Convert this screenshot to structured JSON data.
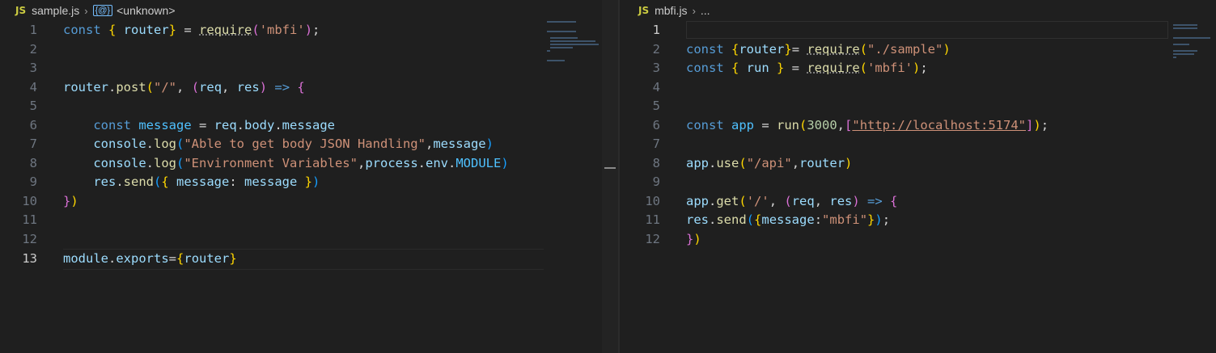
{
  "left": {
    "breadcrumb": {
      "lang": "JS",
      "file": "sample.js",
      "symbol": "<unknown>"
    },
    "lines": [
      {
        "n": "1",
        "tokens": [
          [
            "kw",
            "const "
          ],
          [
            "b1",
            "{ "
          ],
          [
            "vr",
            "router"
          ],
          [
            "b1",
            "}"
          ],
          [
            "pn",
            " = "
          ],
          [
            "fn",
            "require"
          ],
          [
            "b2",
            "("
          ],
          [
            "st",
            "'mbfi'"
          ],
          [
            "b2",
            ")"
          ],
          [
            "pn",
            ";"
          ]
        ]
      },
      {
        "n": "2",
        "tokens": []
      },
      {
        "n": "3",
        "tokens": []
      },
      {
        "n": "4",
        "tokens": [
          [
            "vr",
            "router"
          ],
          [
            "pn",
            "."
          ],
          [
            "fn",
            "post"
          ],
          [
            "b1",
            "("
          ],
          [
            "st",
            "\"/\""
          ],
          [
            "pn",
            ", "
          ],
          [
            "b2",
            "("
          ],
          [
            "vr",
            "req"
          ],
          [
            "pn",
            ", "
          ],
          [
            "vr",
            "res"
          ],
          [
            "b2",
            ")"
          ],
          [
            "kw",
            " => "
          ],
          [
            "b2",
            "{"
          ]
        ]
      },
      {
        "n": "5",
        "tokens": []
      },
      {
        "n": "6",
        "tokens": [
          [
            "pn",
            "    "
          ],
          [
            "kw",
            "const "
          ],
          [
            "cn",
            "message"
          ],
          [
            "pn",
            " = "
          ],
          [
            "vr",
            "req"
          ],
          [
            "pn",
            "."
          ],
          [
            "vr",
            "body"
          ],
          [
            "pn",
            "."
          ],
          [
            "vr",
            "message"
          ]
        ]
      },
      {
        "n": "7",
        "tokens": [
          [
            "pn",
            "    "
          ],
          [
            "vr",
            "console"
          ],
          [
            "pn",
            "."
          ],
          [
            "fn",
            "log"
          ],
          [
            "b3",
            "("
          ],
          [
            "st",
            "\"Able to get body JSON Handling\""
          ],
          [
            "pn",
            ","
          ],
          [
            "vr",
            "message"
          ],
          [
            "b3",
            ")"
          ]
        ]
      },
      {
        "n": "8",
        "tokens": [
          [
            "pn",
            "    "
          ],
          [
            "vr",
            "console"
          ],
          [
            "pn",
            "."
          ],
          [
            "fn",
            "log"
          ],
          [
            "b3",
            "("
          ],
          [
            "st",
            "\"Environment Variables\""
          ],
          [
            "pn",
            ","
          ],
          [
            "vr",
            "process"
          ],
          [
            "pn",
            "."
          ],
          [
            "vr",
            "env"
          ],
          [
            "pn",
            "."
          ],
          [
            "cn",
            "MODULE"
          ],
          [
            "b3",
            ")"
          ]
        ]
      },
      {
        "n": "9",
        "tokens": [
          [
            "pn",
            "    "
          ],
          [
            "vr",
            "res"
          ],
          [
            "pn",
            "."
          ],
          [
            "fn",
            "send"
          ],
          [
            "b3",
            "("
          ],
          [
            "b1",
            "{ "
          ],
          [
            "vr",
            "message"
          ],
          [
            "pn",
            ": "
          ],
          [
            "vr",
            "message"
          ],
          [
            "b1",
            " }"
          ],
          [
            "b3",
            ")"
          ]
        ]
      },
      {
        "n": "10",
        "tokens": [
          [
            "b2",
            "}"
          ],
          [
            "b1",
            ")"
          ]
        ]
      },
      {
        "n": "11",
        "tokens": []
      },
      {
        "n": "12",
        "tokens": []
      },
      {
        "n": "13",
        "tokens": [
          [
            "vr",
            "module"
          ],
          [
            "pn",
            "."
          ],
          [
            "vr",
            "exports"
          ],
          [
            "pn",
            "="
          ],
          [
            "b1",
            "{"
          ],
          [
            "vr",
            "router"
          ],
          [
            "b1",
            "}"
          ]
        ]
      }
    ]
  },
  "right": {
    "breadcrumb": {
      "lang": "JS",
      "file": "mbfi.js",
      "more": "..."
    },
    "lines": [
      {
        "n": "1",
        "tokens": []
      },
      {
        "n": "2",
        "tokens": [
          [
            "kw",
            "const "
          ],
          [
            "b1",
            "{"
          ],
          [
            "vr",
            "router"
          ],
          [
            "b1",
            "}"
          ],
          [
            "pn",
            "= "
          ],
          [
            "fn",
            "require"
          ],
          [
            "b1",
            "("
          ],
          [
            "st",
            "\"./sample\""
          ],
          [
            "b1",
            ")"
          ]
        ]
      },
      {
        "n": "3",
        "tokens": [
          [
            "kw",
            "const "
          ],
          [
            "b1",
            "{ "
          ],
          [
            "vr",
            "run"
          ],
          [
            "b1",
            " }"
          ],
          [
            "pn",
            " = "
          ],
          [
            "fn",
            "require"
          ],
          [
            "b1",
            "("
          ],
          [
            "st",
            "'mbfi'"
          ],
          [
            "b1",
            ")"
          ],
          [
            "pn",
            ";"
          ]
        ]
      },
      {
        "n": "4",
        "tokens": []
      },
      {
        "n": "5",
        "tokens": []
      },
      {
        "n": "6",
        "tokens": [
          [
            "kw",
            "const "
          ],
          [
            "cn",
            "app"
          ],
          [
            "pn",
            " = "
          ],
          [
            "fn",
            "run"
          ],
          [
            "b1",
            "("
          ],
          [
            "nm",
            "3000"
          ],
          [
            "pn",
            ","
          ],
          [
            "b2",
            "["
          ],
          [
            "st",
            "\"http://localhost:5174\""
          ],
          [
            "b2",
            "]"
          ],
          [
            "b1",
            ")"
          ],
          [
            "pn",
            ";"
          ]
        ]
      },
      {
        "n": "7",
        "tokens": []
      },
      {
        "n": "8",
        "tokens": [
          [
            "vr",
            "app"
          ],
          [
            "pn",
            "."
          ],
          [
            "fn",
            "use"
          ],
          [
            "b1",
            "("
          ],
          [
            "st",
            "\"/api\""
          ],
          [
            "pn",
            ","
          ],
          [
            "vr",
            "router"
          ],
          [
            "b1",
            ")"
          ]
        ]
      },
      {
        "n": "9",
        "tokens": []
      },
      {
        "n": "10",
        "tokens": [
          [
            "vr",
            "app"
          ],
          [
            "pn",
            "."
          ],
          [
            "fn",
            "get"
          ],
          [
            "b1",
            "("
          ],
          [
            "st",
            "'/'"
          ],
          [
            "pn",
            ", "
          ],
          [
            "b2",
            "("
          ],
          [
            "vr",
            "req"
          ],
          [
            "pn",
            ", "
          ],
          [
            "vr",
            "res"
          ],
          [
            "b2",
            ")"
          ],
          [
            "kw",
            " => "
          ],
          [
            "b2",
            "{"
          ]
        ]
      },
      {
        "n": "11",
        "tokens": [
          [
            "vr",
            "res"
          ],
          [
            "pn",
            "."
          ],
          [
            "fn",
            "send"
          ],
          [
            "b3",
            "("
          ],
          [
            "b1",
            "{"
          ],
          [
            "vr",
            "message"
          ],
          [
            "pn",
            ":"
          ],
          [
            "st",
            "\"mbfi\""
          ],
          [
            "b1",
            "}"
          ],
          [
            "b3",
            ")"
          ],
          [
            "pn",
            ";"
          ]
        ]
      },
      {
        "n": "12",
        "tokens": [
          [
            "b2",
            "}"
          ],
          [
            "b1",
            ")"
          ]
        ]
      }
    ]
  },
  "active_line": {
    "left": "13",
    "right": "1"
  },
  "colors": {
    "background": "#1f1f1f",
    "keyword": "#569cd6",
    "string": "#ce9178",
    "function": "#dcdcaa",
    "variable": "#9cdcfe"
  }
}
